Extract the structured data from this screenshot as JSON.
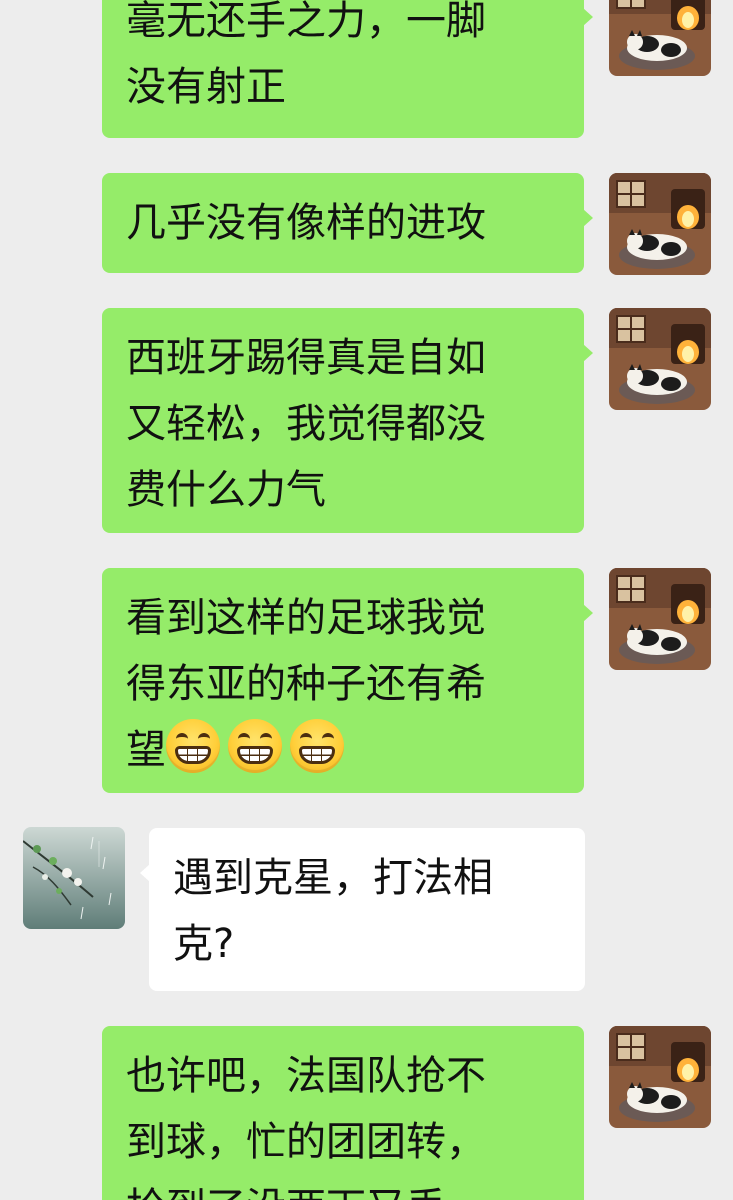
{
  "messages": [
    {
      "sender": "me",
      "lines": [
        "毫无还手之力，一脚",
        "没有射正"
      ]
    },
    {
      "sender": "me",
      "lines": [
        "几乎没有像样的进攻"
      ]
    },
    {
      "sender": "me",
      "lines": [
        "西班牙踢得真是自如",
        "又轻松，我觉得都没",
        "费什么力气"
      ]
    },
    {
      "sender": "me",
      "lines": [
        "看到这样的足球我觉",
        "得东亚的种子还有希",
        "望"
      ],
      "emoji": [
        "grinning-face-icon",
        "grinning-face-icon",
        "grinning-face-icon"
      ]
    },
    {
      "sender": "other",
      "lines": [
        "遇到克星，打法相",
        "克?"
      ]
    },
    {
      "sender": "me",
      "lines": [
        "也许吧，法国队抢不",
        "到球，忙的团团转，",
        "抢到了没两下又丢"
      ]
    }
  ],
  "avatars": {
    "me": "cat-by-fireplace-avatar",
    "other": "rainy-branch-avatar"
  },
  "colors": {
    "background": "#ededed",
    "my_bubble": "#95ec69",
    "other_bubble": "#ffffff",
    "text": "#111111"
  }
}
